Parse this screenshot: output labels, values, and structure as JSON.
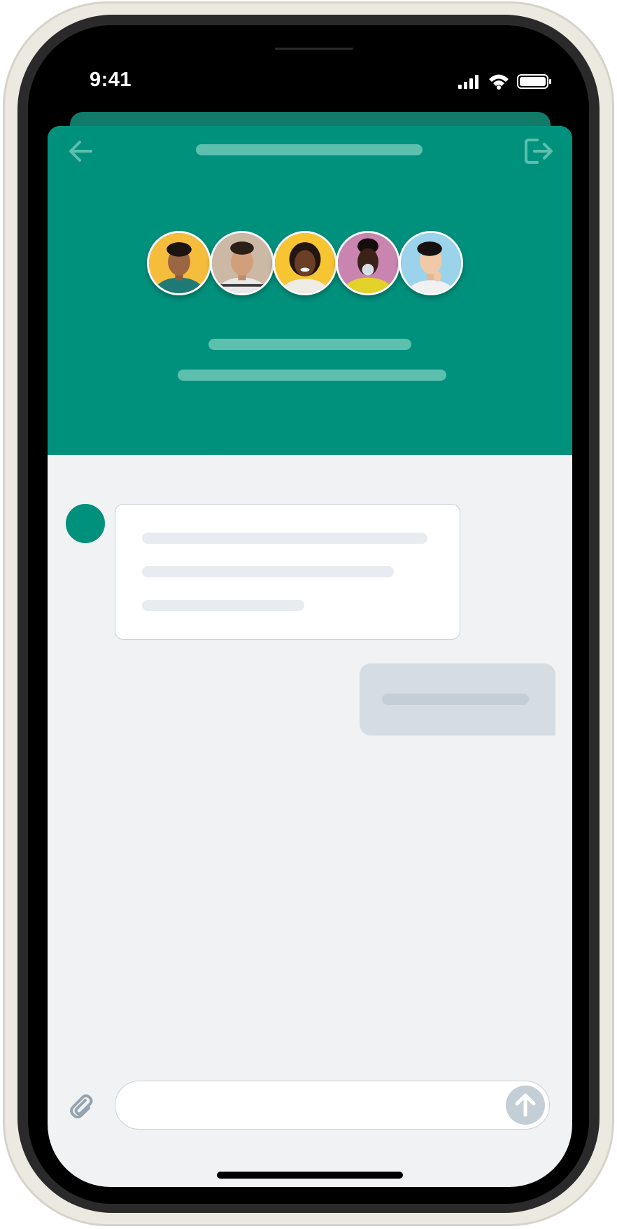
{
  "status_bar": {
    "time": "9:41",
    "icons": [
      "cellular-signal-icon",
      "wifi-icon",
      "battery-icon"
    ]
  },
  "header": {
    "left_icon": "back-arrow-icon",
    "right_icon": "logout-icon",
    "avatars": [
      {
        "bg": "#f6bd3c"
      },
      {
        "bg": "#cbb8a5"
      },
      {
        "bg": "#f7c531"
      },
      {
        "bg": "#c985b0"
      },
      {
        "bg": "#9ad3ea"
      }
    ]
  },
  "composer": {
    "placeholder": "",
    "attach_icon": "paperclip-icon",
    "send_icon": "arrow-up-icon"
  },
  "colors": {
    "brand": "#00917d",
    "background": "#f0f2f4",
    "skeleton_header": "#5dbfae",
    "skeleton_light": "#e8ecf0",
    "outgoing_bubble": "#d5dde3",
    "send_button": "#c4ced6"
  }
}
